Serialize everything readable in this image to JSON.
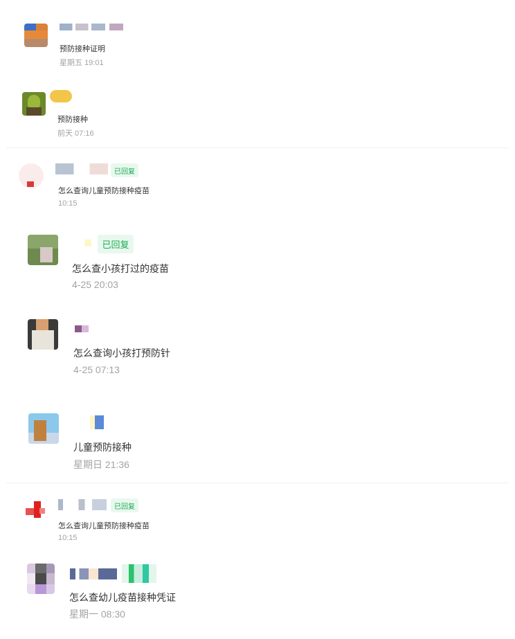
{
  "entries": [
    {
      "message": "预防接种证明",
      "time": "星期五 19:01"
    },
    {
      "message": "预防接种",
      "time": "前天 07:16"
    },
    {
      "message": "怎么查询儿童预防接种疫苗",
      "time": "10:15",
      "badge": "已回复"
    },
    {
      "message": "怎么查小孩打过的疫苗",
      "time": "4-25 20:03",
      "badge": "已回复"
    },
    {
      "message": "怎么查询小孩打预防针",
      "time": "4-25 07:13"
    },
    {
      "message": "儿童预防接种",
      "time": "星期日 21:36"
    },
    {
      "message": "怎么查询儿童预防接种疫苗",
      "time": "10:15",
      "badge": "已回复"
    },
    {
      "message": "怎么查幼儿疫苗接种凭证",
      "time": "星期一 08:30"
    }
  ]
}
